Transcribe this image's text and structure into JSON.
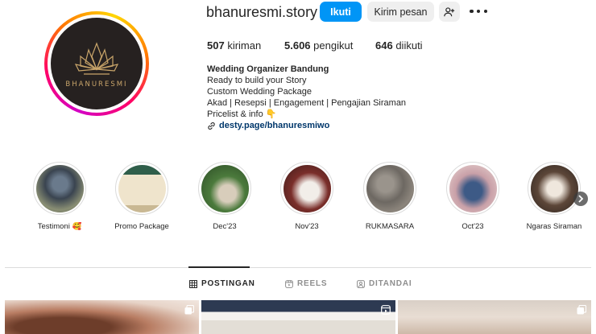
{
  "profile": {
    "username": "bhanuresmi.story",
    "avatar_brand": "BHANURESMI",
    "follow_label": "Ikuti",
    "message_label": "Kirim pesan"
  },
  "stats": {
    "posts": "507",
    "posts_label": "kiriman",
    "followers": "5.606",
    "followers_label": "pengikut",
    "following": "646",
    "following_label": "diikuti"
  },
  "bio": {
    "name": "Wedding Organizer Bandung",
    "lines": [
      "Ready to build your Story",
      "Custom Wedding Package",
      "Akad | Resepsi | Engagement | Pengajian Siraman",
      "Pricelist & info 👇"
    ],
    "link": "desty.page/bhanuresmiwo"
  },
  "highlights": [
    {
      "label": "Testimoni 🥰"
    },
    {
      "label": "Promo Package"
    },
    {
      "label": "Dec'23"
    },
    {
      "label": "Nov'23"
    },
    {
      "label": "RUKMASARA"
    },
    {
      "label": "Oct'23"
    },
    {
      "label": "Ngaras Siraman"
    }
  ],
  "tabs": [
    {
      "label": "POSTINGAN",
      "icon": "grid-icon",
      "active": true
    },
    {
      "label": "REELS",
      "icon": "reels-icon",
      "active": false
    },
    {
      "label": "DITANDAI",
      "icon": "tagged-icon",
      "active": false
    }
  ],
  "colors": {
    "accent": "#0095f6",
    "text": "#262626",
    "link": "#00376b",
    "muted": "#8e8e8e"
  }
}
